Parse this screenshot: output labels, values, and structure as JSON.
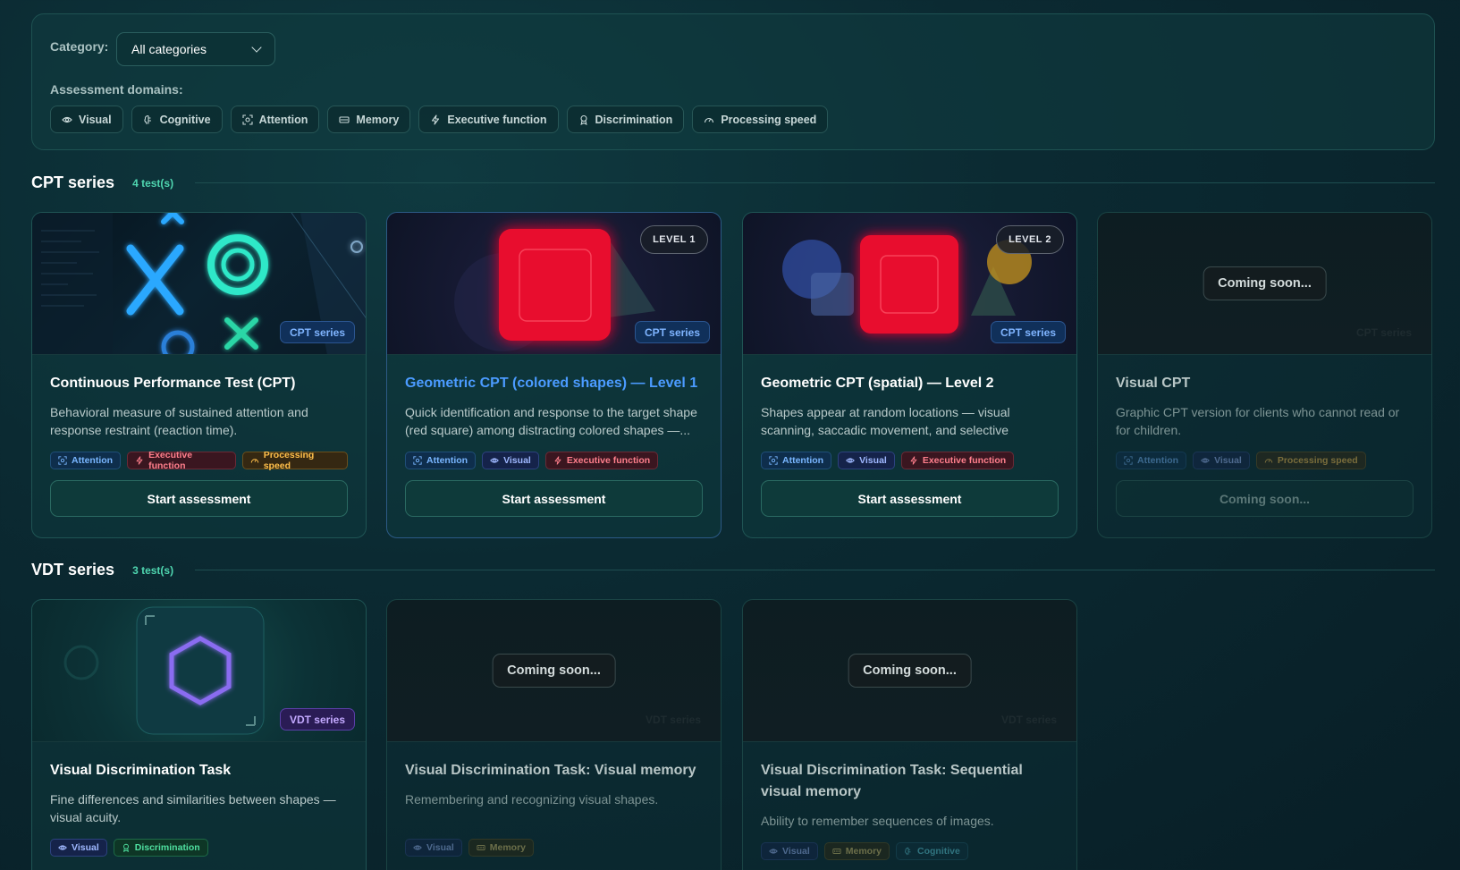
{
  "filters": {
    "category_label": "Category:",
    "category_value": "All categories",
    "domains_label": "Assessment domains:",
    "domains": [
      {
        "label": "Visual",
        "icon": "eye-icon"
      },
      {
        "label": "Cognitive",
        "icon": "brain-icon"
      },
      {
        "label": "Attention",
        "icon": "focus-icon"
      },
      {
        "label": "Memory",
        "icon": "memory-chip-icon"
      },
      {
        "label": "Executive function",
        "icon": "lightning-icon"
      },
      {
        "label": "Discrimination",
        "icon": "award-icon"
      },
      {
        "label": "Processing speed",
        "icon": "gauge-icon"
      }
    ]
  },
  "sections": [
    {
      "title": "CPT series",
      "count": "4 test(s)",
      "cards": [
        {
          "title": "Continuous Performance Test (CPT)",
          "desc": "Behavioral measure of sustained attention and response restraint (reaction time).",
          "badge": "CPT series",
          "tags": [
            "Attention",
            "Executive function",
            "Processing speed"
          ],
          "button": "Start assessment"
        },
        {
          "title": "Geometric CPT (colored shapes) — Level 1",
          "desc": "Quick identification and response to the target shape (red square) among distracting colored shapes —...",
          "badge": "CPT series",
          "level": "LEVEL 1",
          "tags": [
            "Attention",
            "Visual",
            "Executive function"
          ],
          "button": "Start assessment"
        },
        {
          "title": "Geometric CPT (spatial) — Level 2",
          "desc": "Shapes appear at random locations — visual scanning, saccadic movement, and selective spatial...",
          "badge": "CPT series",
          "level": "LEVEL 2",
          "tags": [
            "Attention",
            "Visual",
            "Executive function"
          ],
          "button": "Start assessment"
        },
        {
          "title": "Visual CPT",
          "desc": "Graphic CPT version for clients who cannot read or for children.",
          "badge": "CPT series",
          "overlay": "Coming soon...",
          "tags": [
            "Attention",
            "Visual",
            "Processing speed"
          ],
          "button": "Coming soon..."
        }
      ]
    },
    {
      "title": "VDT series",
      "count": "3 test(s)",
      "cards": [
        {
          "title": "Visual Discrimination Task",
          "desc": "Fine differences and similarities between shapes — visual acuity.",
          "badge": "VDT series",
          "tags": [
            "Visual",
            "Discrimination"
          ]
        },
        {
          "title": "Visual Discrimination Task: Visual memory",
          "desc": "Remembering and recognizing visual shapes.",
          "badge": "VDT series",
          "overlay": "Coming soon...",
          "tags": [
            "Visual",
            "Memory"
          ]
        },
        {
          "title": "Visual Discrimination Task: Sequential visual memory",
          "desc": "Ability to remember sequences of images.",
          "badge": "VDT series",
          "overlay": "Coming soon...",
          "tags": [
            "Visual",
            "Memory",
            "Cognitive"
          ]
        }
      ]
    }
  ],
  "colors": {
    "accent_teal": "#4fd6b0",
    "highlight_title": "#4b9bff",
    "target_red": "#e8102e",
    "background": "#0b2a32"
  }
}
